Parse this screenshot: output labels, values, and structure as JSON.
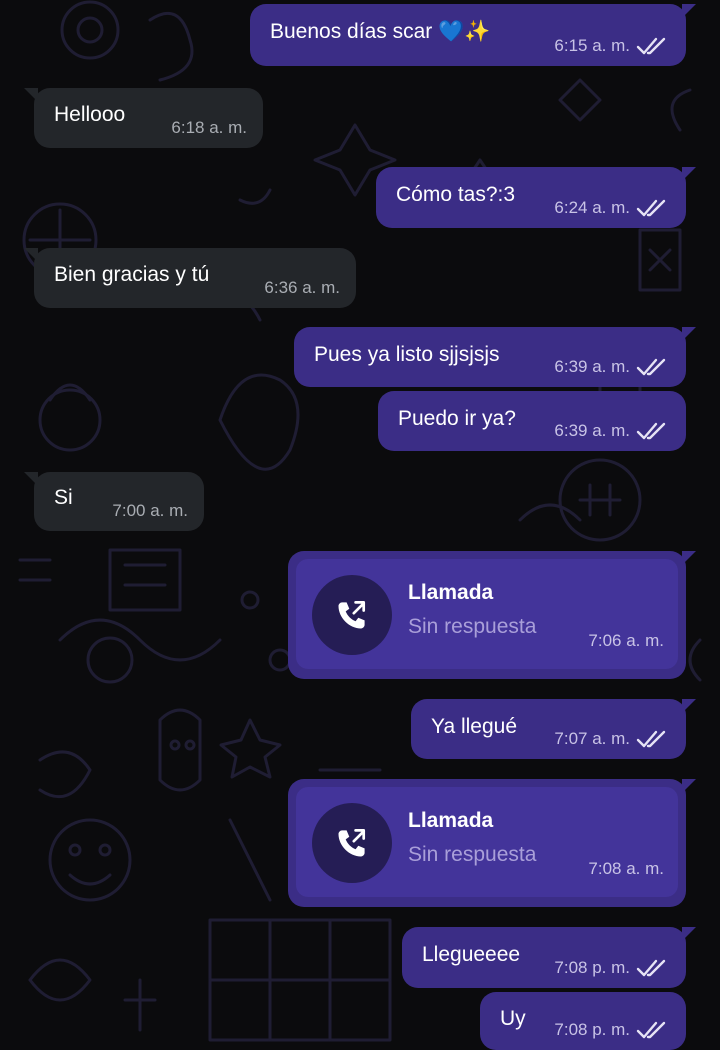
{
  "messages": [
    {
      "type": "text",
      "direction": "out",
      "text": "Buenos días scar 💙✨",
      "time": "6:15 a. m.",
      "read": true
    },
    {
      "type": "text",
      "direction": "in",
      "text": "Hellooo",
      "time": "6:18 a. m."
    },
    {
      "type": "text",
      "direction": "out",
      "text": "Cómo tas?:3",
      "time": "6:24 a. m.",
      "read": true
    },
    {
      "type": "text",
      "direction": "in",
      "text": "Bien gracias y tú",
      "time": "6:36 a. m."
    },
    {
      "type": "text",
      "direction": "out",
      "text": "Pues ya listo sjjsjsjs",
      "time": "6:39 a. m.",
      "read": true
    },
    {
      "type": "text",
      "direction": "out",
      "text": "Puedo ir ya?",
      "time": "6:39 a. m.",
      "read": true
    },
    {
      "type": "text",
      "direction": "in",
      "text": "Si",
      "time": "7:00 a. m."
    },
    {
      "type": "call",
      "direction": "out",
      "title": "Llamada",
      "subtitle": "Sin respuesta",
      "time": "7:06 a. m.",
      "icon": "outgoing-call-icon"
    },
    {
      "type": "text",
      "direction": "out",
      "text": "Ya llegué",
      "time": "7:07 a. m.",
      "read": true
    },
    {
      "type": "call",
      "direction": "out",
      "title": "Llamada",
      "subtitle": "Sin respuesta",
      "time": "7:08 a. m.",
      "icon": "outgoing-call-icon"
    },
    {
      "type": "text",
      "direction": "out",
      "text": "Llegueeee",
      "time": "7:08 p. m.",
      "read": true
    },
    {
      "type": "text",
      "direction": "out",
      "text": "Uy",
      "time": "7:08 p. m.",
      "read": true
    }
  ],
  "colors": {
    "outgoing_bubble": "#3b2d86",
    "incoming_bubble": "#23262a",
    "background": "#0b0b0d",
    "doodle": "#1f1d33"
  }
}
